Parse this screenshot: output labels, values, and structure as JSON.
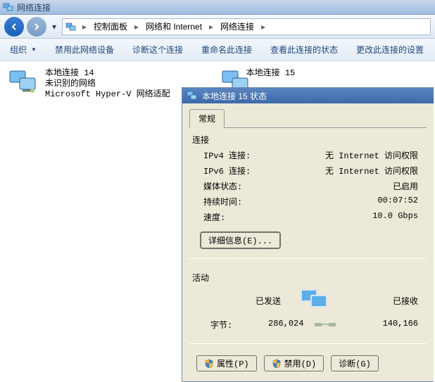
{
  "window": {
    "title": "网络连接"
  },
  "breadcrumb": {
    "items": [
      "控制面板",
      "网络和 Internet",
      "网络连接"
    ]
  },
  "toolbar": {
    "organize": "组织",
    "disable": "禁用此网络设备",
    "diagnose": "诊断这个连接",
    "rename": "重命名此连接",
    "viewstatus": "查看此连接的状态",
    "change": "更改此连接的设置"
  },
  "connections": [
    {
      "name": "本地连接 14",
      "status": "未识别的网络",
      "device": "Microsoft Hyper-V 网络适配"
    },
    {
      "name": "本地连接 15"
    }
  ],
  "dialog": {
    "title": "本地连接 15 状态",
    "tab_general": "常规",
    "section_conn": "连接",
    "rows": {
      "ipv4_label": "IPv4 连接:",
      "ipv4_value": "无 Internet 访问权限",
      "ipv6_label": "IPv6 连接:",
      "ipv6_value": "无 Internet 访问权限",
      "media_label": "媒体状态:",
      "media_value": "已启用",
      "duration_label": "持续时间:",
      "duration_value": "00:07:52",
      "speed_label": "速度:",
      "speed_value": "10.0 Gbps"
    },
    "details_btn": "详细信息(E)...",
    "section_activity": "活动",
    "sent_label": "已发送",
    "recv_label": "已接收",
    "bytes_label": "字节:",
    "bytes_sent": "286,024",
    "bytes_recv": "140,166",
    "btn_prop": "属性(P)",
    "btn_disable": "禁用(D)",
    "btn_diag": "诊断(G)"
  }
}
